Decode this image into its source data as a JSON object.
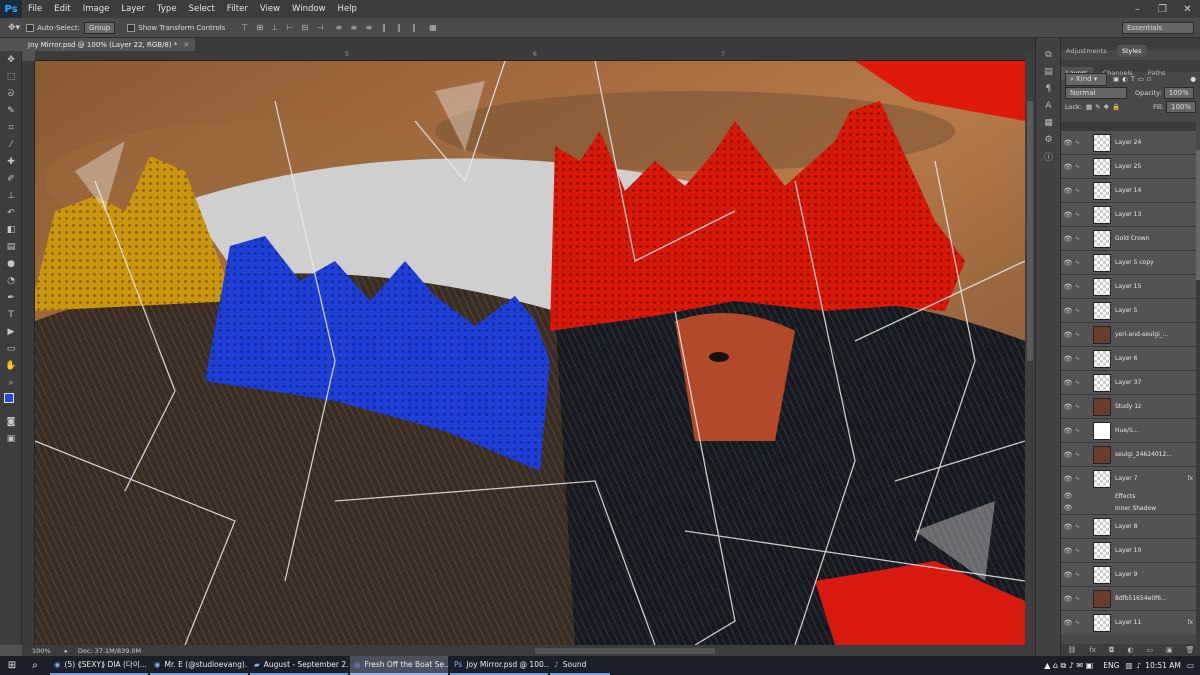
{
  "app": {
    "logo": "Ps"
  },
  "menu": [
    "File",
    "Edit",
    "Image",
    "Layer",
    "Type",
    "Select",
    "Filter",
    "View",
    "Window",
    "Help"
  ],
  "options": {
    "auto_select_label": "Auto-Select:",
    "auto_select_value": "Group",
    "transform_label": "Show Transform Controls",
    "workspace": "Essentials"
  },
  "document": {
    "tab_title": "Joy Mirror.psd @ 100% (Layer 22, RGB/8) *",
    "ruler_marks": [
      "5",
      "6",
      "7"
    ]
  },
  "status": {
    "zoom": "100%",
    "doc": "Doc: 37.1M/839.0M"
  },
  "panel": {
    "top_tabs": [
      "Adjustments",
      "Styles"
    ],
    "tabs": [
      "Layers",
      "Channels",
      "Paths"
    ],
    "kind": "Kind",
    "blend_mode": "Normal",
    "opacity_label": "Opacity:",
    "opacity_value": "100%",
    "lock_label": "Lock:",
    "fill_label": "Fill:",
    "fill_value": "100%"
  },
  "layers": [
    {
      "name": "Layer 24",
      "thumb": "blank"
    },
    {
      "name": "Layer 25",
      "thumb": "blank"
    },
    {
      "name": "Layer 14",
      "thumb": "blank"
    },
    {
      "name": "Layer 13",
      "thumb": "blank"
    },
    {
      "name": "Gold Crown",
      "thumb": "blank"
    },
    {
      "name": "Layer 5 copy",
      "thumb": "blank"
    },
    {
      "name": "Layer 15",
      "thumb": "blank"
    },
    {
      "name": "Layer 5",
      "thumb": "blank"
    },
    {
      "name": "yeri-and-seulgi_...",
      "thumb": "photo"
    },
    {
      "name": "Layer 6",
      "thumb": "blank"
    },
    {
      "name": "Layer 37",
      "thumb": "blank"
    },
    {
      "name": "Study 1z",
      "thumb": "photo"
    },
    {
      "name": "Hue/S...",
      "thumb": "adjust"
    },
    {
      "name": "seulgi_24624012...",
      "thumb": "photo"
    },
    {
      "name": "Layer 7",
      "thumb": "blank",
      "fx": "fx"
    },
    {
      "name": "Effects",
      "sub": true
    },
    {
      "name": "Inner Shadow",
      "sub": true
    },
    {
      "name": "Layer 8",
      "thumb": "blank"
    },
    {
      "name": "Layer 10",
      "thumb": "blank"
    },
    {
      "name": "Layer 9",
      "thumb": "blank"
    },
    {
      "name": "8dfb51654e0f6...",
      "thumb": "photo"
    },
    {
      "name": "Layer 11",
      "thumb": "blank",
      "fx": "fx"
    }
  ],
  "taskbar": {
    "items": [
      {
        "label": "(5) ⟪SEXY⟫ DIA (다이...",
        "icon": "chrome"
      },
      {
        "label": "Mr. E (@studioevang)...",
        "icon": "chrome"
      },
      {
        "label": "August - September 2...",
        "icon": "folder"
      },
      {
        "label": "Fresh Off the Boat Se...",
        "icon": "media"
      },
      {
        "label": "Joy Mirror.psd @ 100...",
        "icon": "photoshop"
      },
      {
        "label": "Sound",
        "icon": "sound"
      }
    ],
    "lang": "ENG",
    "time": "10:51 AM"
  }
}
